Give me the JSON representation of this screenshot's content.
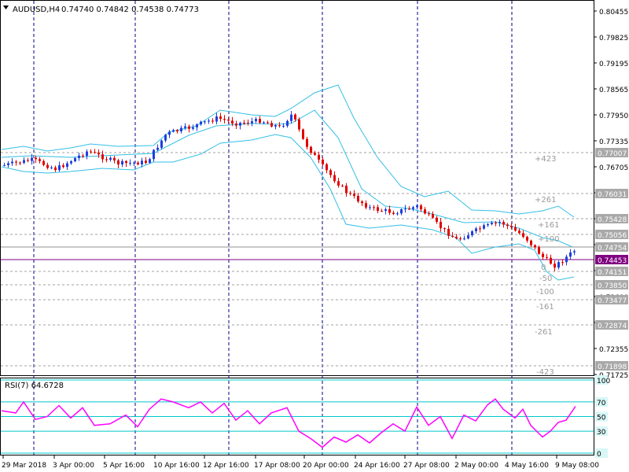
{
  "header": {
    "symbol_timeframe": "AUDUSD,H4",
    "ohlc": "0.74740 0.74842 0.74538 0.74773",
    "collapse_icon": "triangle-down-icon"
  },
  "rsi": {
    "label": "RSI(7) 64.6728",
    "levels": [
      "100",
      "70",
      "50",
      "30",
      "0"
    ],
    "level_values": [
      100,
      70,
      50,
      30,
      0
    ],
    "line_color": "#ff00ff",
    "level_line_color": "#00c8c8"
  },
  "price_axis": {
    "labels": [
      "0.80455",
      "0.79825",
      "0.79195",
      "0.78565",
      "0.77950",
      "0.77335",
      "0.76705",
      "0.76075",
      "0.75445",
      "0.74830",
      "0.74215",
      "0.73600",
      "0.72970",
      "0.72355",
      "0.71725"
    ],
    "range": [
      0.71725,
      0.80455
    ]
  },
  "price_tags": [
    {
      "text": "0.77007",
      "style": "gray"
    },
    {
      "text": "0.76031",
      "style": "gray"
    },
    {
      "text": "0.75428",
      "style": "gray"
    },
    {
      "text": "0.75056",
      "style": "gray"
    },
    {
      "text": "0.74754",
      "style": "gray"
    },
    {
      "text": "0.74453",
      "style": "purple"
    },
    {
      "text": "0.74151",
      "style": "gray"
    },
    {
      "text": "0.73850",
      "style": "gray"
    },
    {
      "text": "0.73477",
      "style": "gray"
    },
    {
      "text": "0.72874",
      "style": "gray"
    },
    {
      "text": "0.71898",
      "style": "gray"
    }
  ],
  "fib_labels": [
    "+423",
    "+261",
    "+161",
    "+100",
    "0",
    "-50",
    "-100",
    "-161",
    "-261",
    "-423"
  ],
  "time_axis": {
    "labels": [
      "29 Mar 2018",
      "3 Apr 00:00",
      "5 Apr 16:00",
      "10 Apr 16:00",
      "12 Apr 16:00",
      "17 Apr 08:00",
      "20 Apr 00:00",
      "24 Apr 16:00",
      "27 Apr 08:00",
      "2 May 00:00",
      "4 May 16:00",
      "9 May 08:00"
    ]
  },
  "colors": {
    "bull_candle": "#1f3fdc",
    "bear_candle": "#e00000",
    "bollinger": "#33bfe6",
    "grid_vertical": "#000080",
    "level_dashed": "#a0a0a0",
    "current_line": "#800080"
  }
}
